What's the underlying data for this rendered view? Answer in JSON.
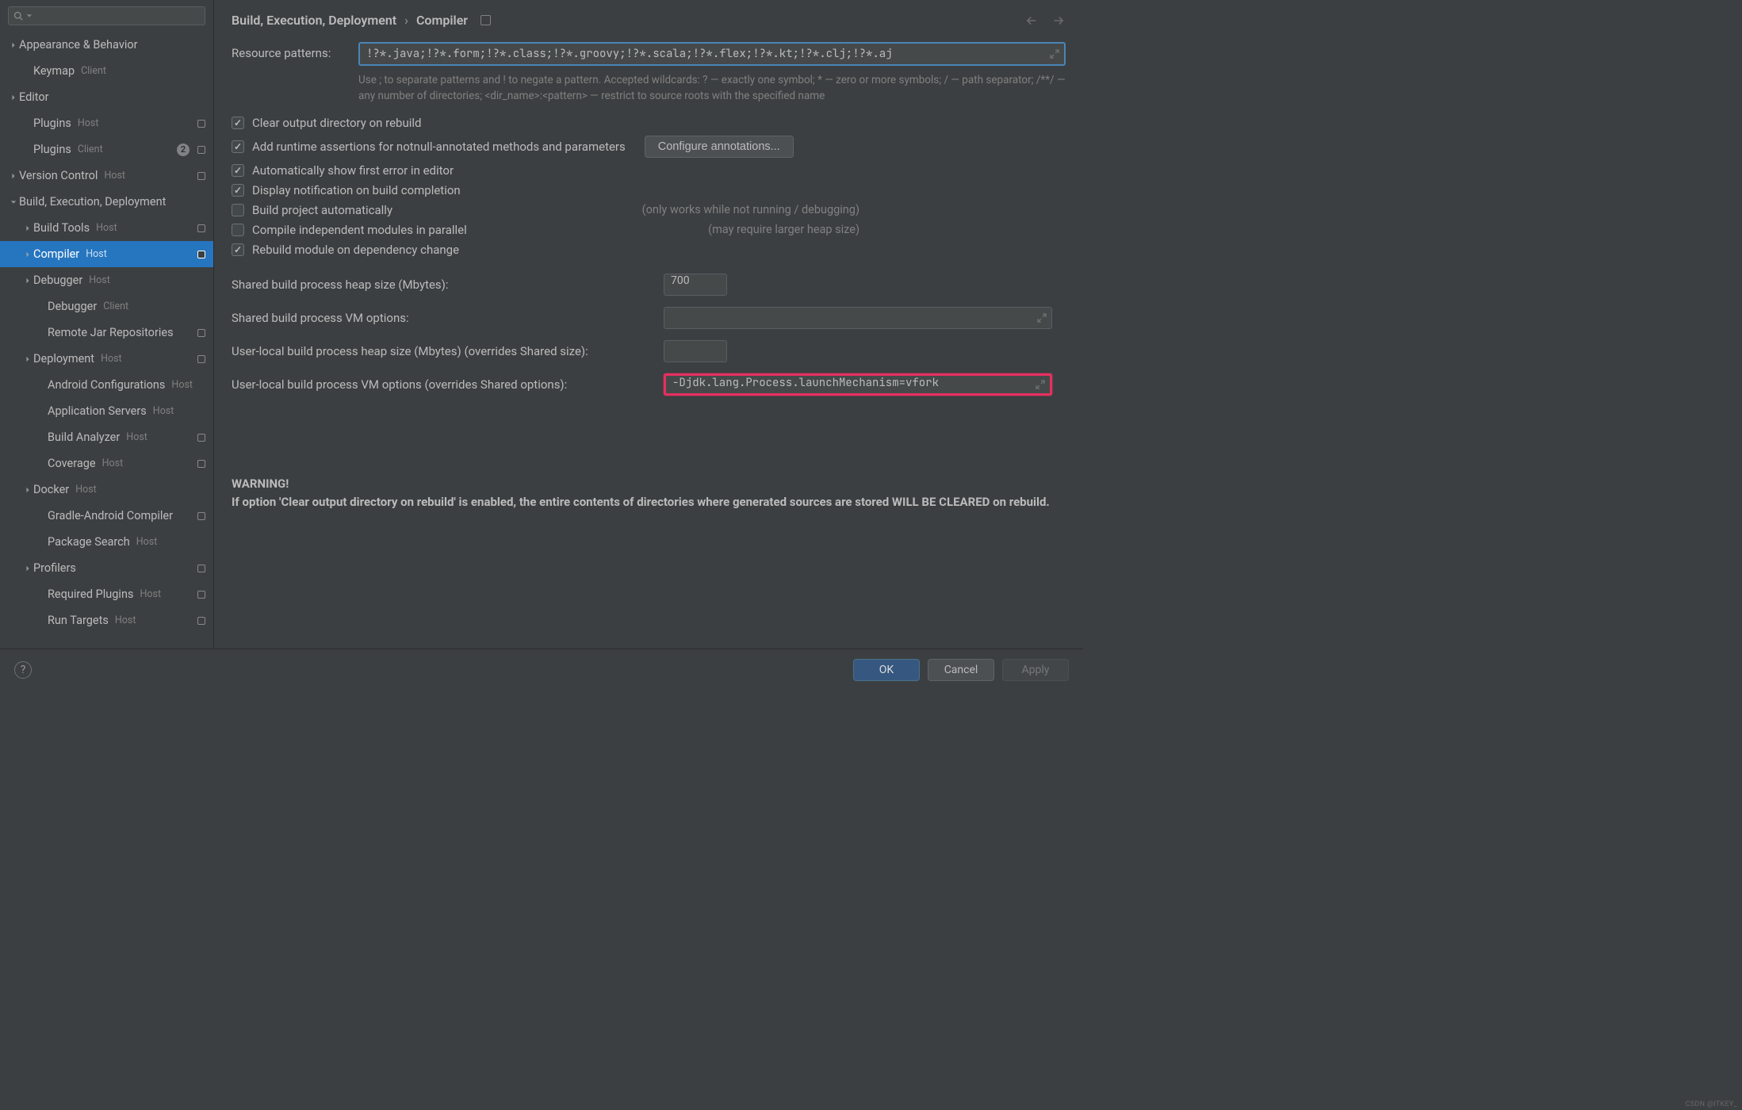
{
  "search": {
    "placeholder": ""
  },
  "sidebar": [
    {
      "label": "Appearance & Behavior",
      "tag": "",
      "indent": 0,
      "chevron": "right",
      "mod": false
    },
    {
      "label": "Keymap",
      "tag": "Client",
      "indent": 1,
      "chevron": "",
      "mod": false
    },
    {
      "label": "Editor",
      "tag": "",
      "indent": 0,
      "chevron": "right",
      "mod": false
    },
    {
      "label": "Plugins",
      "tag": "Host",
      "indent": 1,
      "chevron": "",
      "mod": true
    },
    {
      "label": "Plugins",
      "tag": "Client",
      "indent": 1,
      "chevron": "",
      "mod": true,
      "badge": "2"
    },
    {
      "label": "Version Control",
      "tag": "Host",
      "indent": 0,
      "chevron": "right",
      "mod": true
    },
    {
      "label": "Build, Execution, Deployment",
      "tag": "",
      "indent": 0,
      "chevron": "down",
      "mod": false
    },
    {
      "label": "Build Tools",
      "tag": "Host",
      "indent": 1,
      "chevron": "right",
      "mod": true
    },
    {
      "label": "Compiler",
      "tag": "Host",
      "indent": 1,
      "chevron": "right",
      "mod": true,
      "selected": true
    },
    {
      "label": "Debugger",
      "tag": "Host",
      "indent": 1,
      "chevron": "right",
      "mod": false
    },
    {
      "label": "Debugger",
      "tag": "Client",
      "indent": 2,
      "chevron": "",
      "mod": false
    },
    {
      "label": "Remote Jar Repositories",
      "tag": "",
      "indent": 2,
      "chevron": "",
      "mod": true
    },
    {
      "label": "Deployment",
      "tag": "Host",
      "indent": 1,
      "chevron": "right",
      "mod": true
    },
    {
      "label": "Android Configurations",
      "tag": "Host",
      "indent": 2,
      "chevron": "",
      "mod": false
    },
    {
      "label": "Application Servers",
      "tag": "Host",
      "indent": 2,
      "chevron": "",
      "mod": false
    },
    {
      "label": "Build Analyzer",
      "tag": "Host",
      "indent": 2,
      "chevron": "",
      "mod": true
    },
    {
      "label": "Coverage",
      "tag": "Host",
      "indent": 2,
      "chevron": "",
      "mod": true
    },
    {
      "label": "Docker",
      "tag": "Host",
      "indent": 1,
      "chevron": "right",
      "mod": false
    },
    {
      "label": "Gradle-Android Compiler",
      "tag": "",
      "indent": 2,
      "chevron": "",
      "mod": true
    },
    {
      "label": "Package Search",
      "tag": "Host",
      "indent": 2,
      "chevron": "",
      "mod": false
    },
    {
      "label": "Profilers",
      "tag": "",
      "indent": 1,
      "chevron": "right",
      "mod": true
    },
    {
      "label": "Required Plugins",
      "tag": "Host",
      "indent": 2,
      "chevron": "",
      "mod": true
    },
    {
      "label": "Run Targets",
      "tag": "Host",
      "indent": 2,
      "chevron": "",
      "mod": true
    }
  ],
  "breadcrumb": {
    "root": "Build, Execution, Deployment",
    "leaf": "Compiler"
  },
  "form": {
    "resource_label": "Resource patterns:",
    "resource_value": "!?*.java;!?*.form;!?*.class;!?*.groovy;!?*.scala;!?*.flex;!?*.kt;!?*.clj;!?*.aj",
    "help": "Use ; to separate patterns and ! to negate a pattern. Accepted wildcards: ? — exactly one symbol; * — zero or more symbols; / — path separator; /**/ — any number of directories; <dir_name>:<pattern> — restrict to source roots with the specified name",
    "checks": [
      {
        "label": "Clear output directory on rebuild",
        "checked": true,
        "note": ""
      },
      {
        "label": "Add runtime assertions for notnull-annotated methods and parameters",
        "checked": true,
        "note": "",
        "button": "Configure annotations..."
      },
      {
        "label": "Automatically show first error in editor",
        "checked": true,
        "note": ""
      },
      {
        "label": "Display notification on build completion",
        "checked": true,
        "note": ""
      },
      {
        "label": "Build project automatically",
        "checked": false,
        "note": "(only works while not running / debugging)"
      },
      {
        "label": "Compile independent modules in parallel",
        "checked": false,
        "note": "(may require larger heap size)"
      },
      {
        "label": "Rebuild module on dependency change",
        "checked": true,
        "note": ""
      }
    ],
    "fields": [
      {
        "label": "Shared build process heap size (Mbytes):",
        "value": "700",
        "wide": false
      },
      {
        "label": "Shared build process VM options:",
        "value": "",
        "wide": true
      },
      {
        "label": "User-local build process heap size (Mbytes) (overrides Shared size):",
        "value": "",
        "wide": false
      },
      {
        "label": "User-local build process VM options (overrides Shared options):",
        "value": "-Djdk.lang.Process.launchMechanism=vfork",
        "wide": true,
        "highlight": true
      }
    ],
    "warning_title": "WARNING!",
    "warning_body": "If option 'Clear output directory on rebuild' is enabled, the entire contents of directories where generated sources are stored WILL BE CLEARED on rebuild."
  },
  "footer": {
    "ok": "OK",
    "cancel": "Cancel",
    "apply": "Apply"
  },
  "watermark": "CSDN @ITKEY_"
}
